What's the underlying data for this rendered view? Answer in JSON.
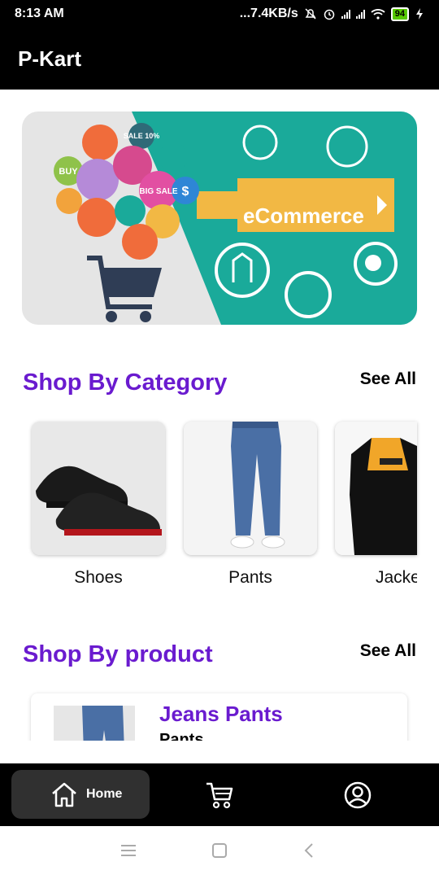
{
  "status_bar": {
    "time": "8:13 AM",
    "network_speed": "...7.4KB/s",
    "battery": "94",
    "icons": [
      "alarm-off-icon",
      "alarm-icon",
      "signal-icon",
      "signal-icon",
      "wifi-icon",
      "battery-icon",
      "charging-icon"
    ]
  },
  "app_bar": {
    "title": "P-Kart"
  },
  "banner": {
    "label": "eCommerce",
    "badges": [
      "BUY",
      "SALE 10%",
      "BIG SALE",
      "$"
    ],
    "colors": {
      "teal": "#1aaa9a",
      "ribbon": "#f2b844",
      "gray": "#e5e5e5"
    }
  },
  "category_section": {
    "title": "Shop By Category",
    "see_all": "See All",
    "items": [
      {
        "label": "Shoes"
      },
      {
        "label": "Pants"
      },
      {
        "label": "Jacke"
      }
    ]
  },
  "product_section": {
    "title": "Shop By product",
    "see_all": "See All",
    "items": [
      {
        "name": "Jeans Pants",
        "category": "Pants"
      }
    ]
  },
  "bottom_nav": {
    "items": [
      {
        "label": "Home",
        "icon": "home-icon",
        "active": true
      },
      {
        "label": "",
        "icon": "cart-icon",
        "active": false
      },
      {
        "label": "",
        "icon": "profile-icon",
        "active": false
      }
    ]
  },
  "system_nav": {
    "icons": [
      "menu-icon",
      "home-square-icon",
      "back-icon"
    ]
  },
  "theme": {
    "accent": "#6a1bcf",
    "bar": "#000000"
  }
}
